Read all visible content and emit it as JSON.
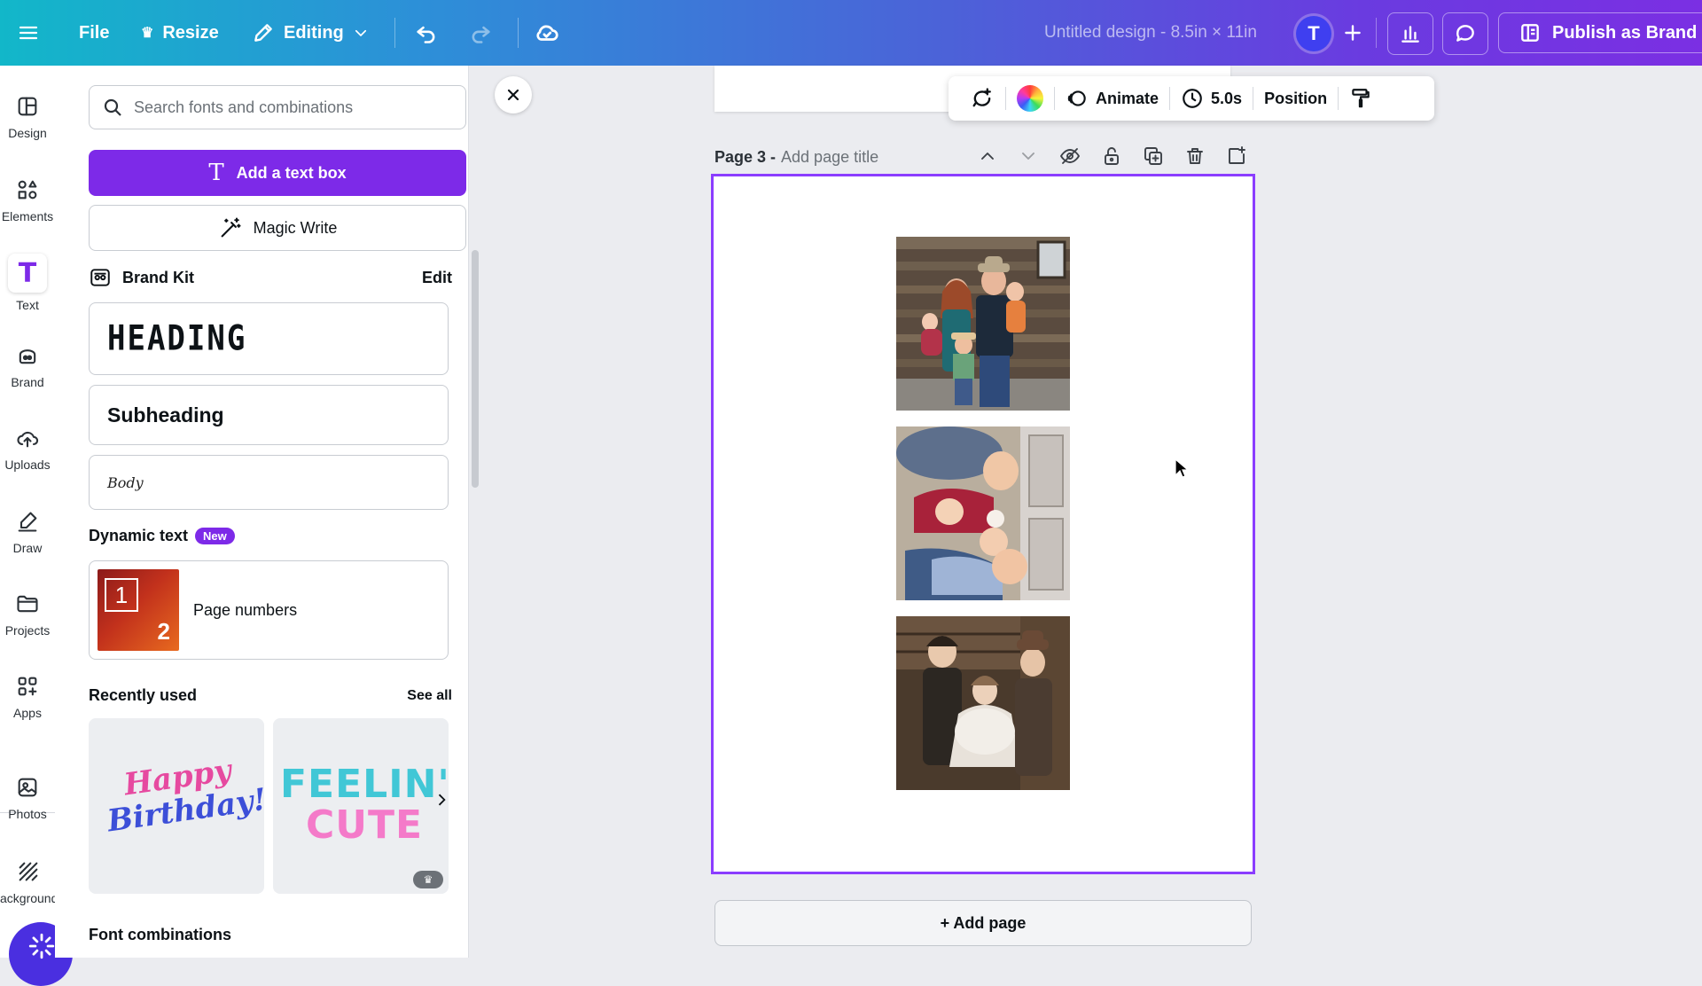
{
  "topbar": {
    "file_label": "File",
    "resize_label": "Resize",
    "editing_label": "Editing",
    "doc_title": "Untitled design - 8.5in × 11in",
    "avatar_initial": "T",
    "publish_label": "Publish as Brand Ten",
    "icons": [
      "menu-icon",
      "crown-icon",
      "pencil-icon",
      "chevron-down-icon",
      "undo-icon",
      "redo-icon",
      "cloud-save-icon",
      "plus-icon",
      "analytics-icon",
      "comment-icon",
      "brand-template-icon"
    ]
  },
  "rail": {
    "items": [
      {
        "label": "Design",
        "icon": "layout-icon"
      },
      {
        "label": "Elements",
        "icon": "shapes-icon"
      },
      {
        "label": "Text",
        "icon": "text-icon"
      },
      {
        "label": "Brand",
        "icon": "brand-icon"
      },
      {
        "label": "Uploads",
        "icon": "cloud-upload-icon"
      },
      {
        "label": "Draw",
        "icon": "draw-icon"
      },
      {
        "label": "Projects",
        "icon": "folder-icon"
      },
      {
        "label": "Apps",
        "icon": "apps-icon"
      },
      {
        "label": "Photos",
        "icon": "photo-icon"
      },
      {
        "label": "ackground",
        "icon": "background-icon"
      }
    ],
    "active": "Text"
  },
  "panel": {
    "search_placeholder": "Search fonts and combinations",
    "add_text_box": "Add a text box",
    "magic_write": "Magic Write",
    "brand_kit": {
      "title": "Brand Kit",
      "edit": "Edit"
    },
    "styles": {
      "heading": "HEADING",
      "subheading": "Subheading",
      "body": "Body"
    },
    "dynamic_text": {
      "title": "Dynamic text",
      "badge": "New",
      "item": "Page numbers",
      "thumb_1": "1",
      "thumb_2": "2"
    },
    "recently_used": {
      "title": "Recently used",
      "see_all": "See all",
      "items": [
        {
          "line1": "Happy",
          "line2": "Birthday!"
        },
        {
          "line1": "FEELIN'",
          "line2": "CUTE"
        }
      ]
    },
    "font_combinations": "Font combinations"
  },
  "canvas": {
    "toolbar": {
      "animate": "Animate",
      "duration": "5.0s",
      "position": "Position"
    },
    "page_label": "Page 3 -",
    "page_title_placeholder": "Add page title",
    "add_page": "+ Add page",
    "accent_color": "#8b3dff"
  }
}
